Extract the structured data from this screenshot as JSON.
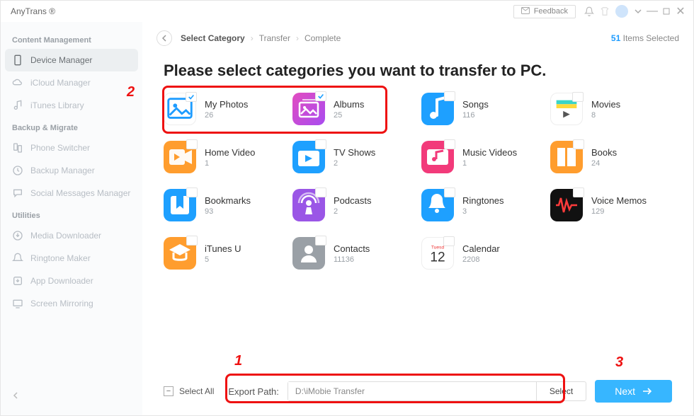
{
  "app_name": "AnyTrans ®",
  "titlebar": {
    "feedback": "Feedback"
  },
  "sidebar": {
    "sections": [
      {
        "label": "Content Management",
        "items": [
          {
            "name": "device-manager",
            "label": "Device Manager",
            "icon": "phone",
            "active": true
          },
          {
            "name": "icloud-manager",
            "label": "iCloud Manager",
            "icon": "cloud"
          },
          {
            "name": "itunes-library",
            "label": "iTunes Library",
            "icon": "music-note"
          }
        ]
      },
      {
        "label": "Backup & Migrate",
        "items": [
          {
            "name": "phone-switcher",
            "label": "Phone Switcher",
            "icon": "swap"
          },
          {
            "name": "backup-manager",
            "label": "Backup Manager",
            "icon": "history"
          },
          {
            "name": "social-messages",
            "label": "Social Messages Manager",
            "icon": "chat"
          }
        ]
      },
      {
        "label": "Utilities",
        "items": [
          {
            "name": "media-downloader",
            "label": "Media Downloader",
            "icon": "download"
          },
          {
            "name": "ringtone-maker",
            "label": "Ringtone Maker",
            "icon": "bell"
          },
          {
            "name": "app-downloader",
            "label": "App Downloader",
            "icon": "app-down"
          },
          {
            "name": "screen-mirroring",
            "label": "Screen Mirroring",
            "icon": "mirror"
          }
        ]
      }
    ]
  },
  "breadcrumbs": [
    "Select Category",
    "Transfer",
    "Complete"
  ],
  "items_selected": 51,
  "items_selected_suffix": "Items Selected",
  "page_title": "Please select categories you want to transfer to PC.",
  "categories": [
    {
      "name": "my-photos",
      "label": "My Photos",
      "count": 26,
      "bg": "#ffffff",
      "checked": true,
      "icon": "photo",
      "iconColor": "#1e9cff",
      "border": true
    },
    {
      "name": "albums",
      "label": "Albums",
      "count": 25,
      "bg": "linear-gradient(135deg,#e24cc0,#a84cf0)",
      "checked": true,
      "icon": "albums"
    },
    {
      "name": "songs",
      "label": "Songs",
      "count": 116,
      "bg": "#1ea0ff",
      "checked": false,
      "icon": "songs"
    },
    {
      "name": "movies",
      "label": "Movies",
      "count": 8,
      "bg": "#fff",
      "checked": false,
      "icon": "movies",
      "border": true
    },
    {
      "name": "home-video",
      "label": "Home Video",
      "count": 1,
      "bg": "#ff9d2e",
      "checked": false,
      "icon": "video"
    },
    {
      "name": "tv-shows",
      "label": "TV Shows",
      "count": 2,
      "bg": "#1ea0ff",
      "checked": false,
      "icon": "tv"
    },
    {
      "name": "music-videos",
      "label": "Music Videos",
      "count": 1,
      "bg": "#f23a7a",
      "checked": false,
      "icon": "mvideo"
    },
    {
      "name": "books",
      "label": "Books",
      "count": 24,
      "bg": "#ff9d2e",
      "checked": false,
      "icon": "books"
    },
    {
      "name": "bookmarks",
      "label": "Bookmarks",
      "count": 93,
      "bg": "#1ea0ff",
      "checked": false,
      "icon": "bookmarks"
    },
    {
      "name": "podcasts",
      "label": "Podcasts",
      "count": 2,
      "bg": "#9a56e6",
      "checked": false,
      "icon": "podcasts"
    },
    {
      "name": "ringtones",
      "label": "Ringtones",
      "count": 3,
      "bg": "#1ea0ff",
      "checked": false,
      "icon": "ringtones"
    },
    {
      "name": "voice-memos",
      "label": "Voice Memos",
      "count": 129,
      "bg": "#111",
      "checked": false,
      "icon": "voicememo"
    },
    {
      "name": "itunes-u",
      "label": "iTunes U",
      "count": 5,
      "bg": "#ff9d2e",
      "checked": false,
      "icon": "itunesu"
    },
    {
      "name": "contacts",
      "label": "Contacts",
      "count": 11136,
      "bg": "#9aa0a6",
      "checked": false,
      "icon": "contacts"
    },
    {
      "name": "calendar",
      "label": "Calendar",
      "count": 2208,
      "bg": "#fff",
      "checked": false,
      "icon": "calendar",
      "border": true
    }
  ],
  "footer": {
    "select_all": "Select All",
    "export_label": "Export Path:",
    "export_path": "D:\\iMobie Transfer",
    "select_btn": "Select",
    "next": "Next"
  },
  "annotations": {
    "step1": "1",
    "step2": "2",
    "step3": "3"
  }
}
